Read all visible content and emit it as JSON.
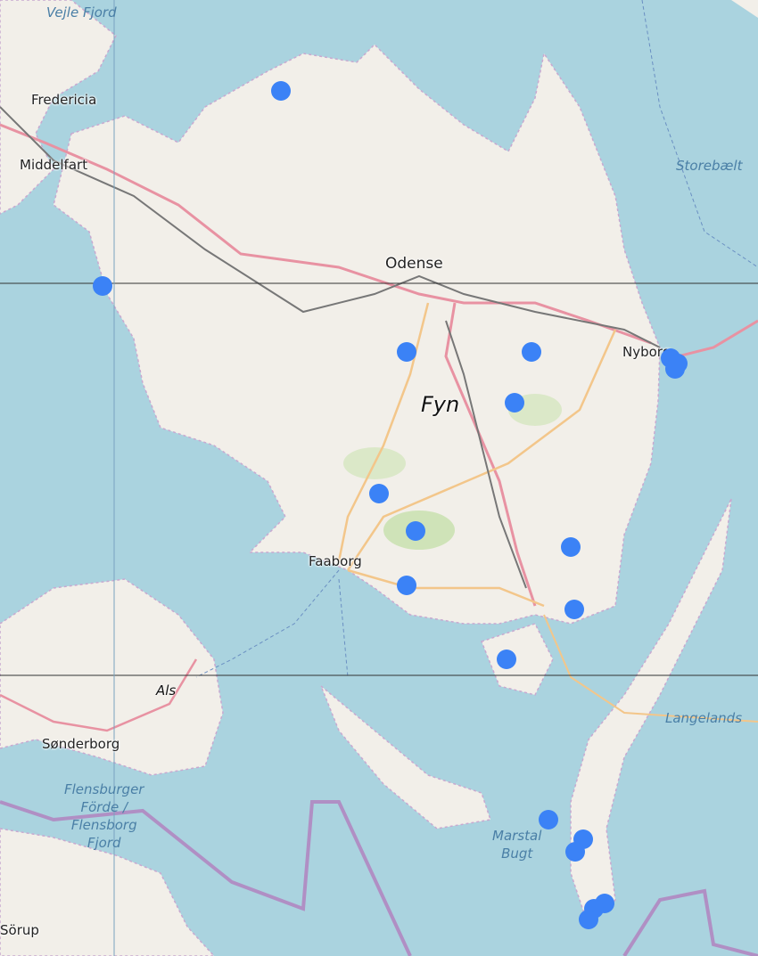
{
  "map": {
    "labels": {
      "vejle_fjord": "Vejle Fjord",
      "fredericia": "Fredericia",
      "middelfart": "Middelfart",
      "storebaelt": "Storebælt",
      "odense": "Odense",
      "fyn": "Fyn",
      "nyborg": "Nyborg",
      "faaborg": "Faaborg",
      "als": "Als",
      "langelands": "Langelands",
      "sonderborg": "Sønderborg",
      "flensburger_line1": "Flensburger",
      "flensburger_line2": "Förde /",
      "flensburger_line3": "Flensborg",
      "flensburger_line4": "Fjord",
      "marstal_line1": "Marstal",
      "marstal_line2": "Bugt",
      "sorup": "Sörup"
    },
    "colors": {
      "water": "#aad3df",
      "land": "#f2efe9",
      "marker": "#3b82f6",
      "motorway": "#e892a2",
      "primary_road": "#fcd6a4",
      "railway": "#707070",
      "border": "#b08fc4"
    },
    "markers": [
      {
        "label": "marker-1"
      },
      {
        "label": "marker-2"
      },
      {
        "label": "marker-3"
      },
      {
        "label": "marker-4"
      },
      {
        "label": "marker-5"
      },
      {
        "label": "marker-6"
      },
      {
        "label": "marker-7"
      },
      {
        "label": "marker-8"
      },
      {
        "label": "marker-9"
      },
      {
        "label": "marker-10"
      },
      {
        "label": "marker-11"
      },
      {
        "label": "marker-12"
      },
      {
        "label": "marker-13"
      },
      {
        "label": "marker-14"
      },
      {
        "label": "marker-15"
      },
      {
        "label": "marker-16"
      },
      {
        "label": "marker-17"
      },
      {
        "label": "marker-18"
      },
      {
        "label": "marker-19"
      },
      {
        "label": "marker-20"
      }
    ]
  }
}
